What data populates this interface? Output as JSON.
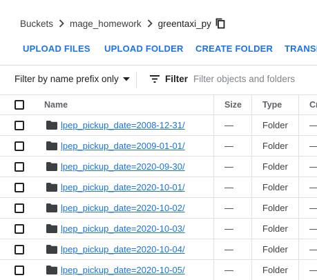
{
  "breadcrumb": {
    "root": "Buckets",
    "bucket": "mage_homework",
    "current": "greentaxi_py"
  },
  "toolbar": {
    "upload_files": "UPLOAD FILES",
    "upload_folder": "UPLOAD FOLDER",
    "create_folder": "CREATE FOLDER",
    "transfer": "TRANSF"
  },
  "filter": {
    "prefix_mode": "Filter by name prefix only",
    "button_label": "Filter",
    "placeholder": "Filter objects and folders"
  },
  "table": {
    "headers": {
      "name": "Name",
      "size": "Size",
      "type": "Type",
      "created": "Cr"
    },
    "rows": [
      {
        "name": "lpep_pickup_date=2008-12-31/",
        "size": "—",
        "type": "Folder",
        "created": "—"
      },
      {
        "name": "lpep_pickup_date=2009-01-01/",
        "size": "—",
        "type": "Folder",
        "created": "—"
      },
      {
        "name": "lpep_pickup_date=2020-09-30/",
        "size": "—",
        "type": "Folder",
        "created": "—"
      },
      {
        "name": "lpep_pickup_date=2020-10-01/",
        "size": "—",
        "type": "Folder",
        "created": "—"
      },
      {
        "name": "lpep_pickup_date=2020-10-02/",
        "size": "—",
        "type": "Folder",
        "created": "—"
      },
      {
        "name": "lpep_pickup_date=2020-10-03/",
        "size": "—",
        "type": "Folder",
        "created": "—"
      },
      {
        "name": "lpep_pickup_date=2020-10-04/",
        "size": "—",
        "type": "Folder",
        "created": "—"
      },
      {
        "name": "lpep_pickup_date=2020-10-05/",
        "size": "—",
        "type": "Folder",
        "created": "—"
      }
    ]
  },
  "icons": {
    "breadcrumb_separator": "chevron-right-icon",
    "copy": "copy-icon",
    "dropdown": "caret-down-icon",
    "filter": "filter-icon",
    "folder": "folder-icon"
  },
  "colors": {
    "accent": "#1a73e8",
    "text": "#202124",
    "divider": "#dadce0"
  }
}
